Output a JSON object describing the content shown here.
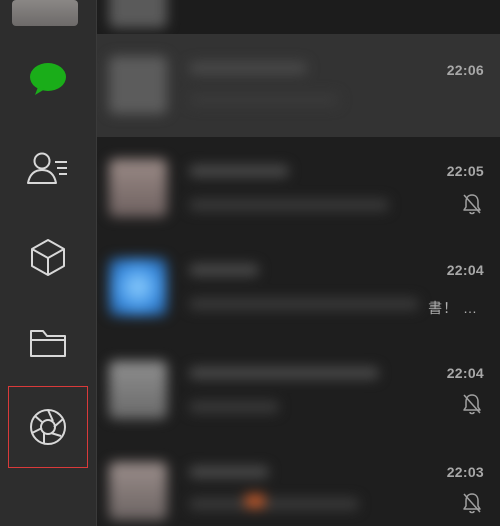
{
  "sidebar": {
    "items": [
      {
        "name": "chats",
        "icon": "chat-bubble-icon",
        "active": true
      },
      {
        "name": "contacts",
        "icon": "contacts-icon"
      },
      {
        "name": "favorites",
        "icon": "cube-icon"
      },
      {
        "name": "files",
        "icon": "folder-icon"
      },
      {
        "name": "moments",
        "icon": "aperture-icon",
        "highlighted": true
      }
    ],
    "colors": {
      "active": "#1aad19",
      "icon": "#d8d8d8",
      "highlight_outline": "#d93a3a"
    }
  },
  "chats": [
    {
      "time": "22:06",
      "muted": false,
      "active": true
    },
    {
      "time": "22:05",
      "muted": true
    },
    {
      "time": "22:04",
      "muted": false,
      "snippet": "書！ …"
    },
    {
      "time": "22:04",
      "muted": true
    },
    {
      "time": "22:03",
      "muted": true
    }
  ]
}
